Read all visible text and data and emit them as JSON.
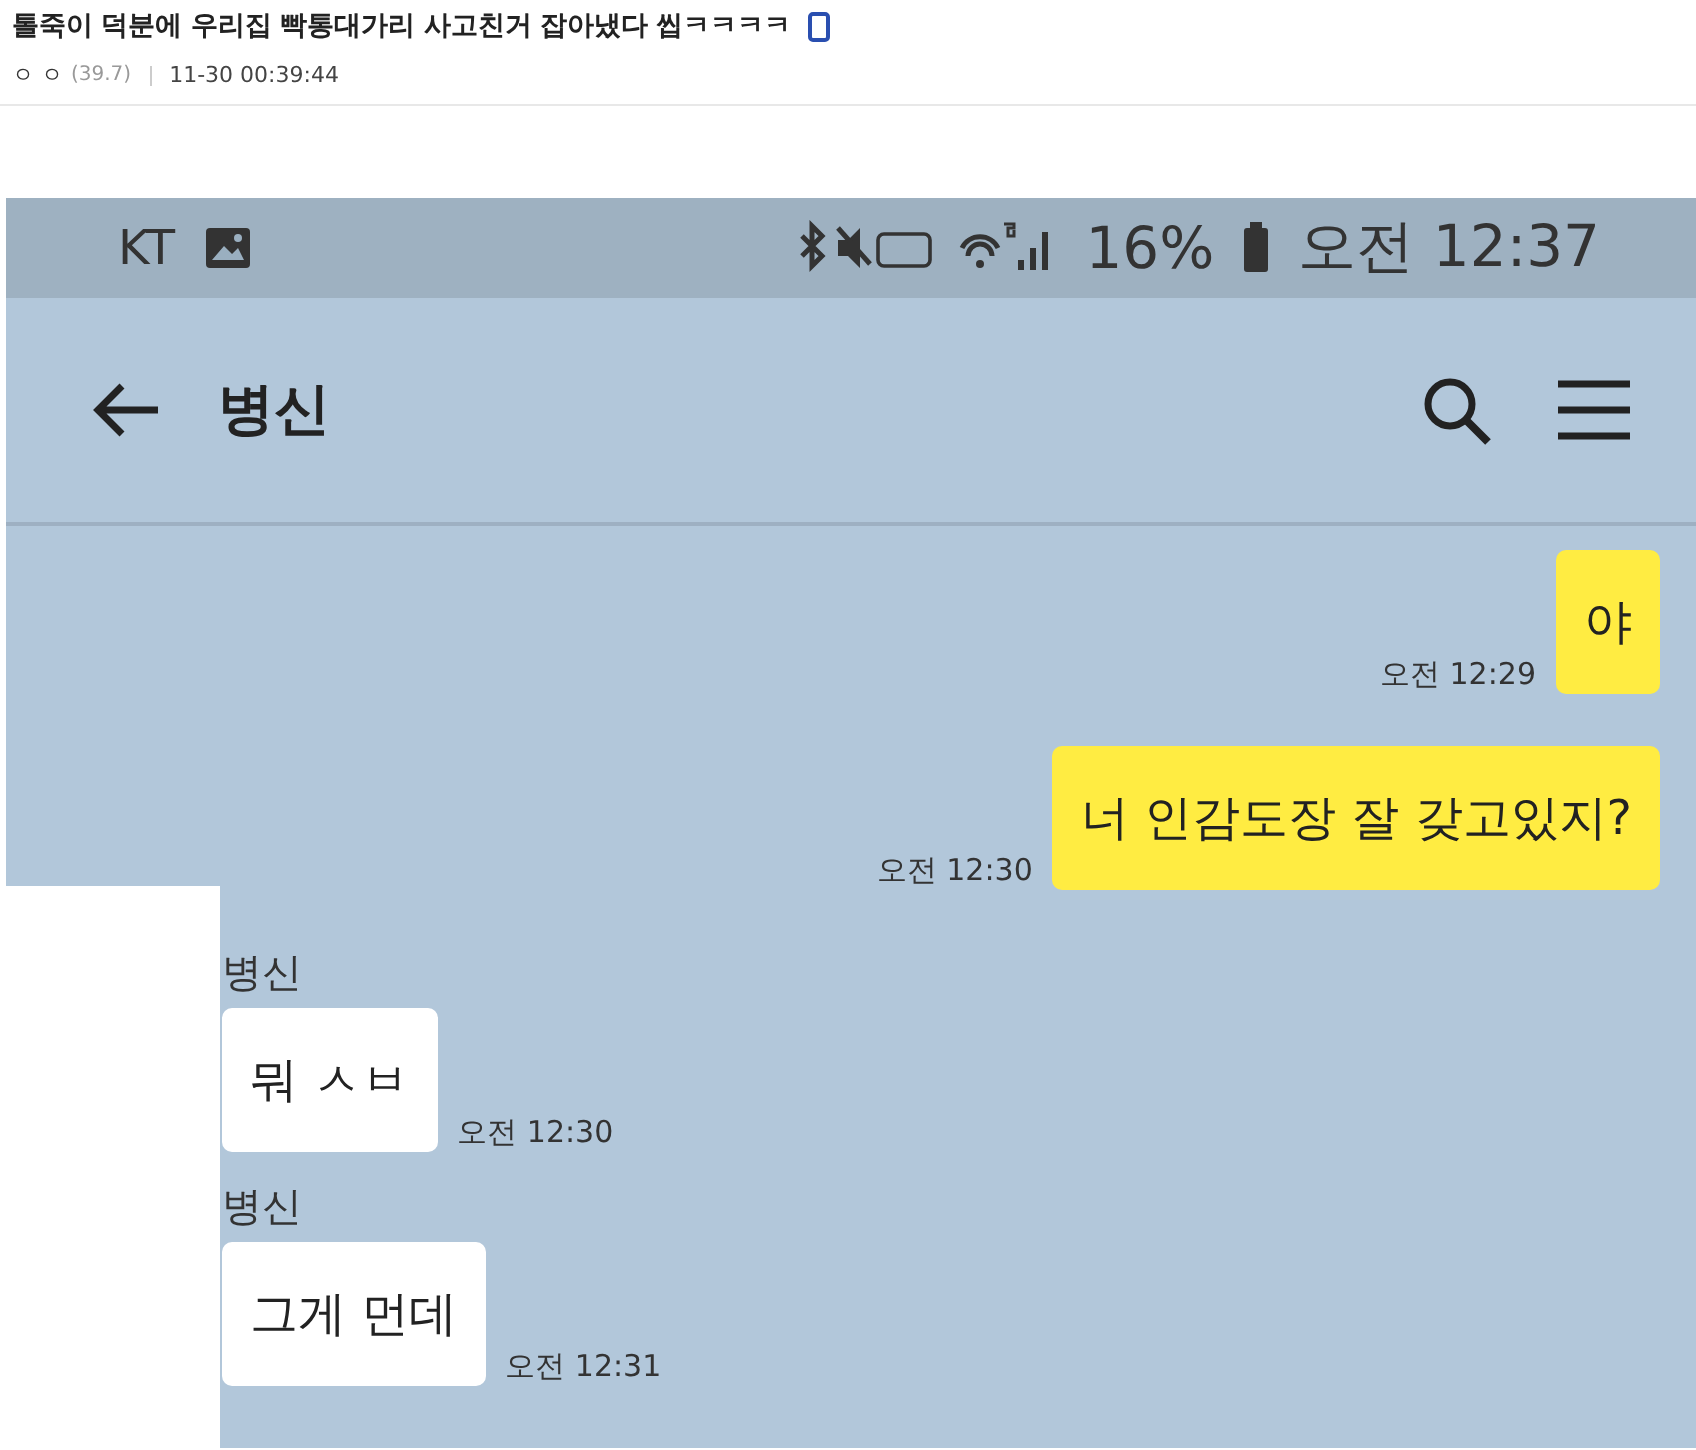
{
  "post": {
    "title": "톨죽이 덕분에 우리집 빡통대가리 사고친거 잡아냈다 씹ㅋㅋㅋㅋ",
    "author": "ㅇ ㅇ",
    "score": "(39.7)",
    "date": "11-30 00:39:44"
  },
  "status_bar": {
    "carrier": "KT",
    "battery": "16%",
    "time": "오전 12:37"
  },
  "chat_header": {
    "title": "병신"
  },
  "messages": [
    {
      "kind": "sent",
      "text": "야",
      "time": "오전 12:29"
    },
    {
      "kind": "sent",
      "text": "너 인감도장 잘 갖고있지?",
      "time": "오전 12:30"
    },
    {
      "kind": "received",
      "sender": "병신",
      "text": "뭐 ㅅㅂ",
      "time": "오전 12:30"
    },
    {
      "kind": "received",
      "sender": "병신",
      "text": "그게 먼데",
      "time": "오전 12:31"
    }
  ]
}
